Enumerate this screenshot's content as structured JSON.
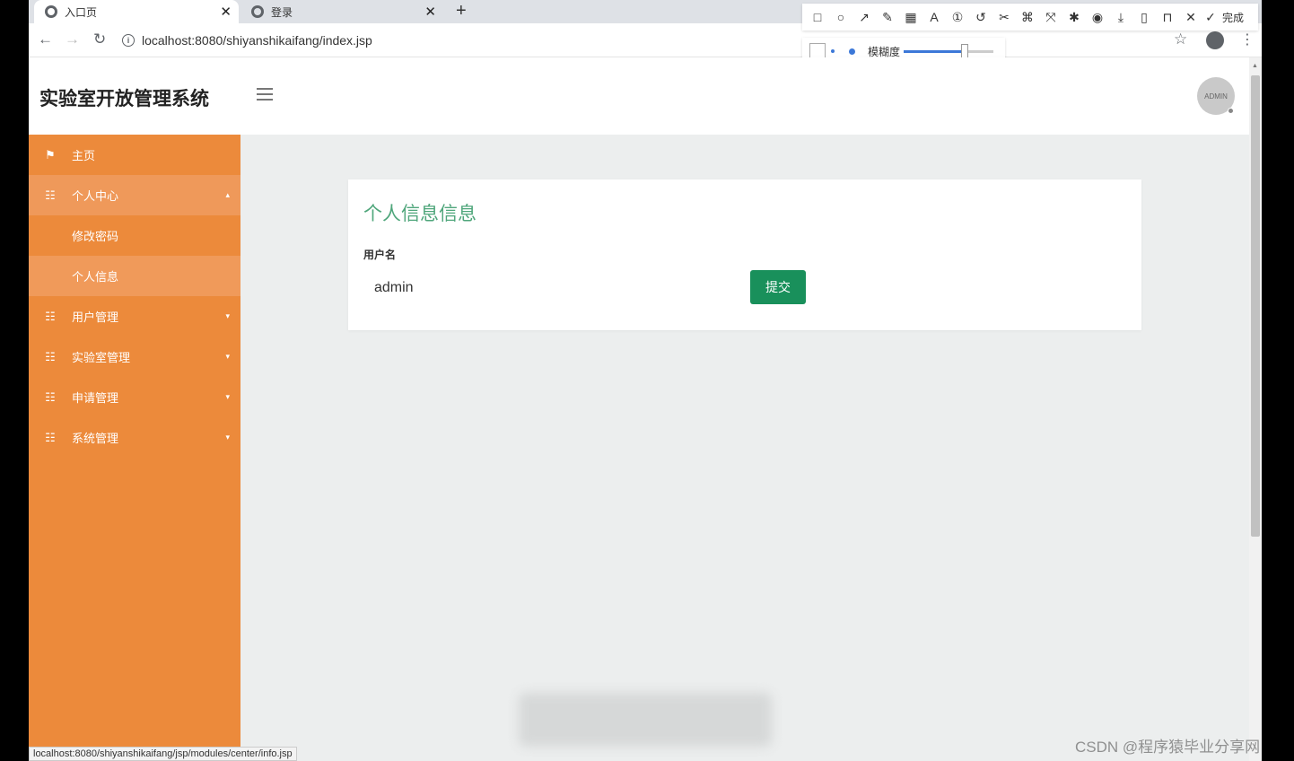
{
  "browser": {
    "tabs": [
      {
        "label": "入口页",
        "active": true
      },
      {
        "label": "登录",
        "active": false
      }
    ],
    "close_glyph": "✕",
    "new_tab_glyph": "+",
    "url": "localhost:8080/shiyanshikaifang/index.jsp",
    "status_url": "localhost:8080/shiyanshikaifang/jsp/modules/center/info.jsp"
  },
  "screenshot_tool": {
    "done_label": "完成",
    "blur_label": "模糊度",
    "blur_level": 0.64,
    "icons": [
      "rectangle-icon",
      "circle-icon",
      "arrow-icon",
      "pencil-icon",
      "mosaic-icon",
      "text-icon",
      "number-icon",
      "undo-icon",
      "crop-icon",
      "translate-icon",
      "expand-icon",
      "pin-icon",
      "record-icon",
      "download-icon",
      "phone-icon",
      "bookmark-icon",
      "cancel-icon"
    ]
  },
  "app": {
    "title": "实验室开放管理系统",
    "avatar_text": "ADMIN"
  },
  "sidebar": {
    "items": [
      {
        "label": "主页",
        "icon": "flag-icon",
        "type": "top"
      },
      {
        "label": "个人中心",
        "icon": "grid-icon",
        "type": "group",
        "caret": "▴"
      },
      {
        "label": "修改密码",
        "type": "sub"
      },
      {
        "label": "个人信息",
        "type": "sub"
      },
      {
        "label": "用户管理",
        "icon": "grid-icon",
        "type": "group",
        "caret": "▾"
      },
      {
        "label": "实验室管理",
        "icon": "grid-icon",
        "type": "group",
        "caret": "▾"
      },
      {
        "label": "申请管理",
        "icon": "grid-icon",
        "type": "group",
        "caret": "▾"
      },
      {
        "label": "系统管理",
        "icon": "grid-icon",
        "type": "group",
        "caret": "▾"
      }
    ]
  },
  "main": {
    "card_title": "个人信息信息",
    "field_label": "用户名",
    "field_value": "admin",
    "submit_label": "提交"
  },
  "watermark": "CSDN @程序猿毕业分享网",
  "colors": {
    "sidebar": "#ec8a3b",
    "accent_green": "#19905b",
    "title_green": "#4fa67b",
    "content_bg": "#eceeee"
  }
}
